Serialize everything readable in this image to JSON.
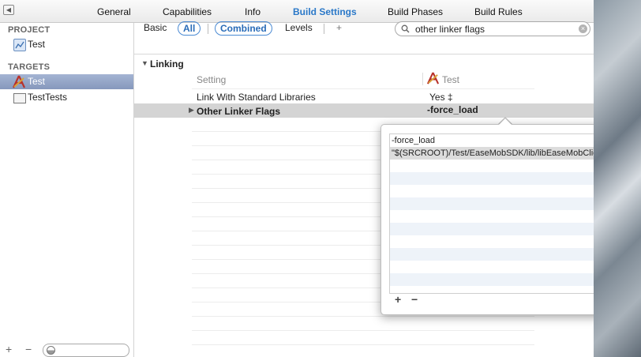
{
  "tabs": [
    "General",
    "Capabilities",
    "Info",
    "Build Settings",
    "Build Phases",
    "Build Rules"
  ],
  "sidebar": {
    "project_header": "PROJECT",
    "project_item": "Test",
    "targets_header": "TARGETS",
    "targets": [
      "Test",
      "TestTests"
    ],
    "add": "+",
    "remove": "−"
  },
  "filter": {
    "basic": "Basic",
    "all": "All",
    "combined": "Combined",
    "levels": "Levels",
    "add": "+",
    "search_value": "other linker flags"
  },
  "section": {
    "title": "Linking",
    "col_setting": "Setting",
    "col_target": "Test"
  },
  "settings": [
    {
      "name": "Link With Standard Libraries",
      "value": "Yes ‡"
    },
    {
      "name": "Other Linker Flags",
      "value": "-force_load"
    }
  ],
  "popover": {
    "items": [
      "-force_load",
      "\"$(SRCROOT)/Test/EaseMobSDK/lib/libEaseMobClien..."
    ],
    "add": "+",
    "remove": "−"
  }
}
